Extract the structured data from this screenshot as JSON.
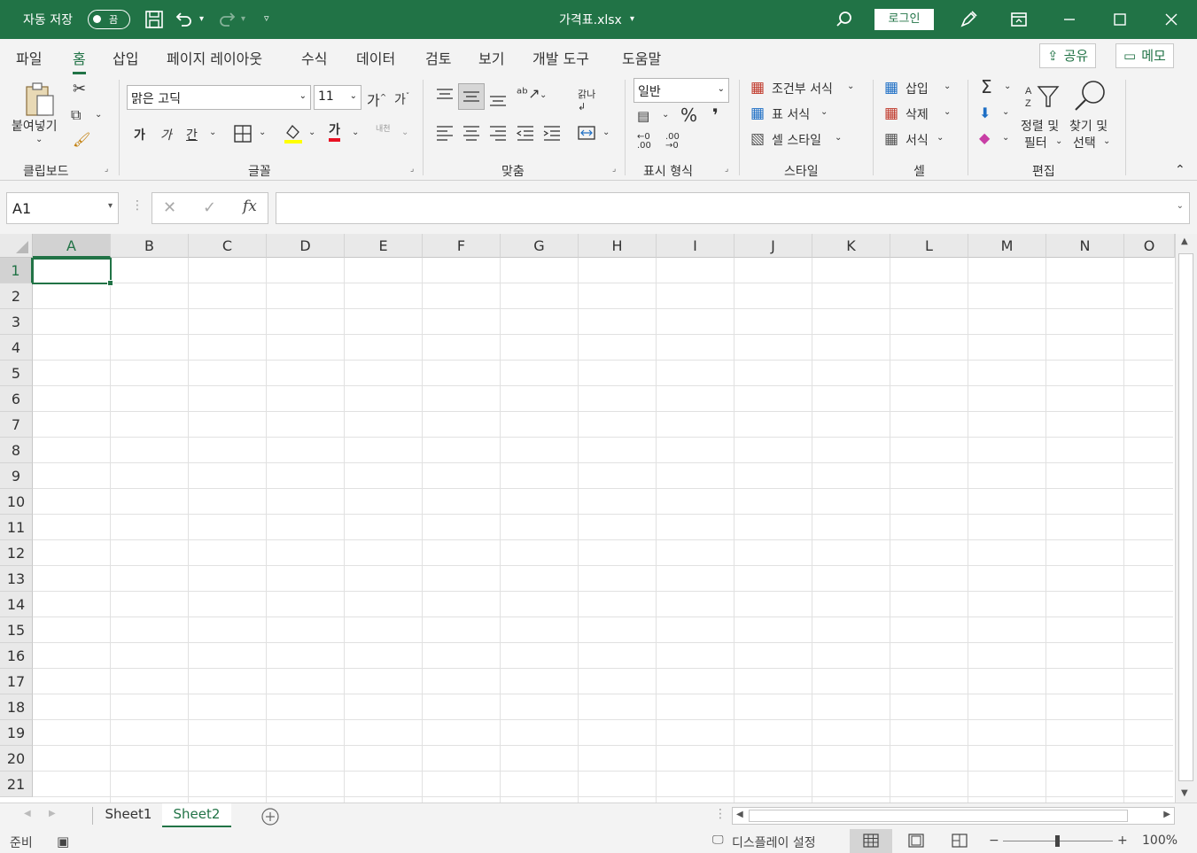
{
  "titlebar": {
    "autosave_label": "자동 저장",
    "autosave_state": "끔",
    "filename": "가격표.xlsx",
    "login": "로그인"
  },
  "ribbon_tabs": [
    "파일",
    "홈",
    "삽입",
    "페이지 레이아웃",
    "수식",
    "데이터",
    "검토",
    "보기",
    "개발 도구",
    "도움말"
  ],
  "active_tab": "홈",
  "share": {
    "share_label": "공유",
    "memo_label": "메모"
  },
  "clipboard": {
    "paste": "붙여넣기",
    "group": "클립보드"
  },
  "font": {
    "name": "맑은 고딕",
    "size": "11",
    "grow": "가",
    "shrink": "가",
    "bold": "가",
    "italic": "가",
    "underline": "간",
    "color_char": "가",
    "phonetic": "내천",
    "group": "글꼴"
  },
  "alignment": {
    "wrap": "갉나",
    "group": "맞춤"
  },
  "number": {
    "format": "일반",
    "percent": "%",
    "comma": "❜",
    "group": "표시 형식"
  },
  "styles": {
    "conditional": "조건부 서식",
    "table": "표 서식",
    "cell": "셀 스타일",
    "group": "스타일"
  },
  "cells": {
    "insert": "삽입",
    "delete": "삭제",
    "format": "서식",
    "group": "셀"
  },
  "editing": {
    "sort1": "정렬 및",
    "sort2": "필터",
    "find1": "찾기 및",
    "find2": "선택",
    "group": "편집"
  },
  "formula_bar": {
    "name_box": "A1",
    "fx": "fx",
    "value": ""
  },
  "columns": [
    "A",
    "B",
    "C",
    "D",
    "E",
    "F",
    "G",
    "H",
    "I",
    "J",
    "K",
    "L",
    "M",
    "N",
    "O"
  ],
  "rows": [
    "1",
    "2",
    "3",
    "4",
    "5",
    "6",
    "7",
    "8",
    "9",
    "10",
    "11",
    "12",
    "13",
    "14",
    "15",
    "16",
    "17",
    "18",
    "19",
    "20",
    "21"
  ],
  "selected_cell": "A1",
  "sheets": [
    "Sheet1",
    "Sheet2"
  ],
  "active_sheet": "Sheet2",
  "status": {
    "ready": "준비",
    "display": "디스플레이 설정",
    "zoom": "100%"
  }
}
